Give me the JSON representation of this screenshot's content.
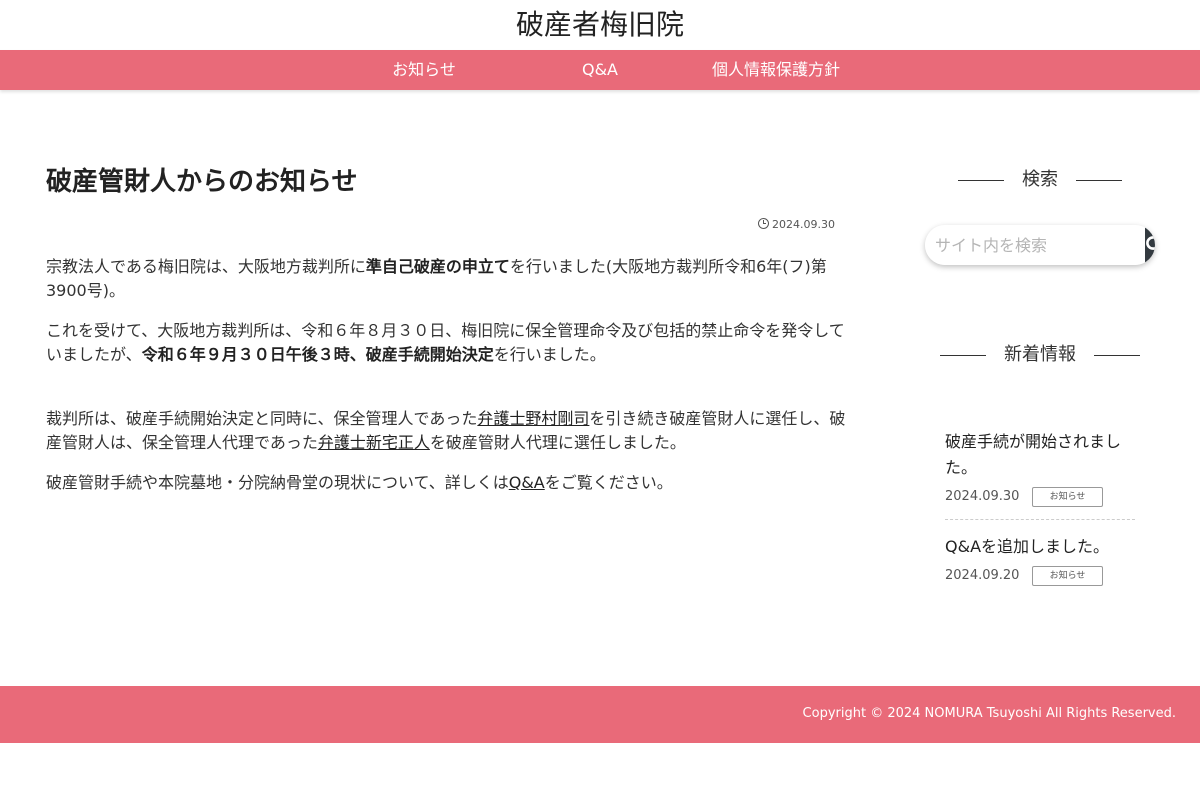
{
  "site": {
    "title": "破産者梅旧院"
  },
  "nav": {
    "items": [
      {
        "label": "お知らせ"
      },
      {
        "label": "Q&A"
      },
      {
        "label": "個人情報保護方針"
      }
    ]
  },
  "article": {
    "title": "破産管財人からのお知らせ",
    "date": "2024.09.30",
    "p1": {
      "t1": "宗教法人である梅旧院は、大阪地方裁判所に",
      "b1": "準自己破産の申立て",
      "t2": "を行いました(大阪地方裁判所令和6年(フ)第3900号)。"
    },
    "p2": {
      "t1": "これを受けて、大阪地方裁判所は、令和６年８月３０日、梅旧院に保全管理命令及び包括的禁止命令を発令していましたが、",
      "b1": "令和６年９月３０日午後３時、破産手続開始決定",
      "t2": "を行いました。"
    },
    "p3": {
      "t1": "裁判所は、破産手続開始決定と同時に、保全管理人であった",
      "link1": "弁護士野村剛司",
      "t2": "を引き続き破産管財人に選任し、破産管財人は、保全管理人代理であった",
      "link2": "弁護士新宅正人",
      "t3": "を破産管財人代理に選任しました。"
    },
    "p4": {
      "t1": "破産管財手続や本院墓地・分院納骨堂の現状について、詳しくは",
      "link1": "Q&A",
      "t2": "をご覧ください。"
    }
  },
  "sidebar": {
    "search_title": "検索",
    "search_placeholder": "サイト内を検索",
    "news_title": "新着情報",
    "news": [
      {
        "title": "破産手続が開始されました。",
        "date": "2024.09.30",
        "category": "お知らせ"
      },
      {
        "title": "Q&Aを追加しました。",
        "date": "2024.09.20",
        "category": "お知らせ"
      }
    ]
  },
  "footer": {
    "copyright": "Copyright © 2024 NOMURA Tsuyoshi All Rights Reserved."
  },
  "colors": {
    "accent": "#e96a79",
    "search_button": "#333a40"
  },
  "icons": {
    "date": "clock-icon",
    "search": "search-icon"
  }
}
